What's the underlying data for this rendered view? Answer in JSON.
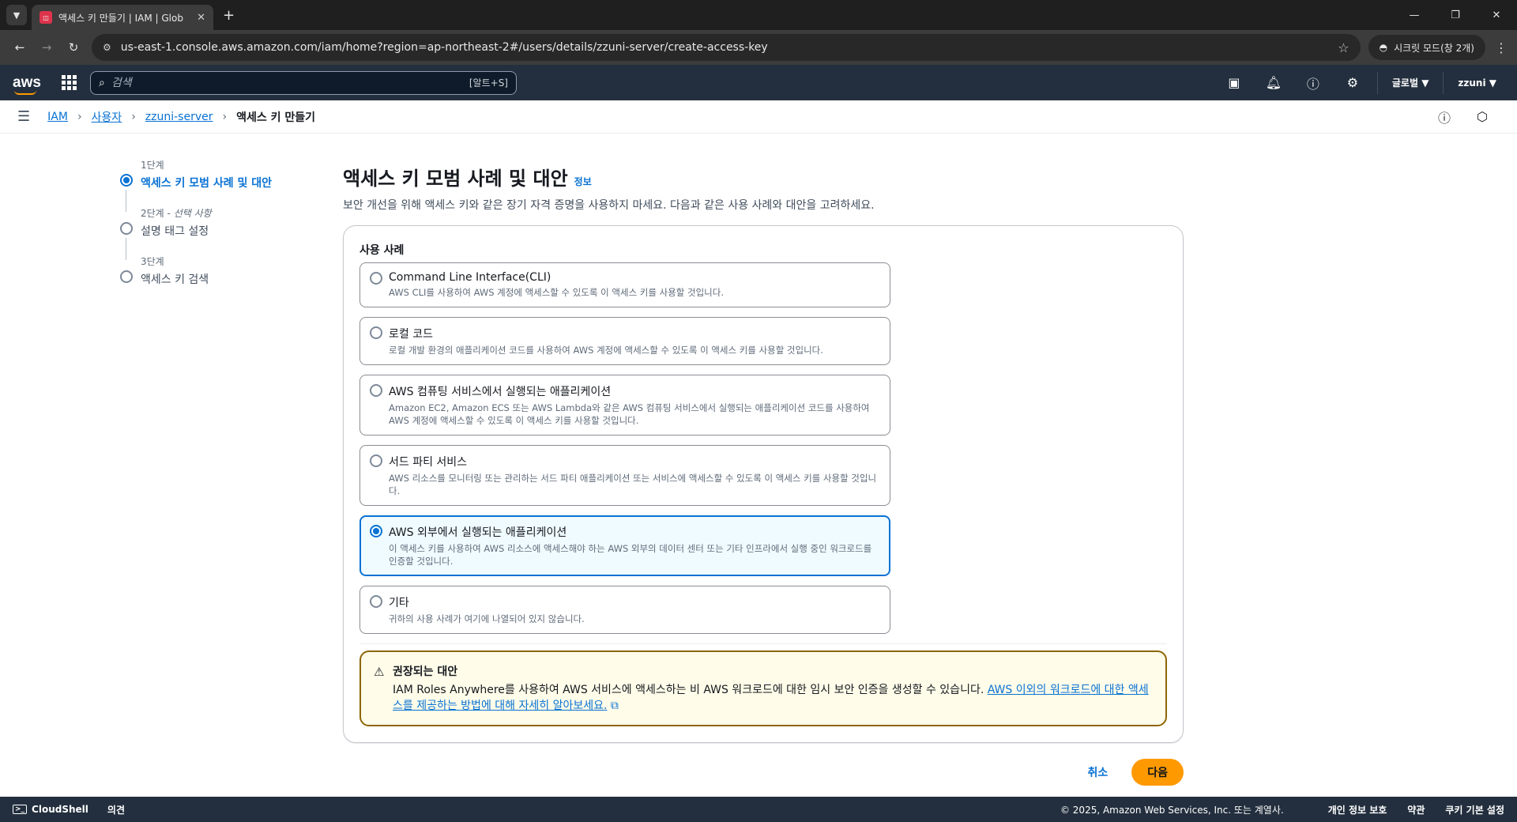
{
  "browser": {
    "tab_title": "액세스 키 만들기 | IAM | Glob",
    "url": "us-east-1.console.aws.amazon.com/iam/home?region=ap-northeast-2#/users/details/zzuni-server/create-access-key",
    "incognito_label": "시크릿 모드(창 2개)"
  },
  "awsnav": {
    "logo": "aws",
    "search_placeholder": "검색",
    "search_shortcut": "[알트+S]",
    "region": "글로벌 ▼",
    "account": "zzuni ▼"
  },
  "breadcrumb": {
    "items": [
      "IAM",
      "사용자",
      "zzuni-server"
    ],
    "current": "액세스 키 만들기"
  },
  "steps": [
    {
      "num": "1단계",
      "title": "액세스 키 모범 사례 및 대안"
    },
    {
      "num": "2단계",
      "optional": "선택 사항",
      "title": "설명 태그 설정"
    },
    {
      "num": "3단계",
      "title": "액세스 키 검색"
    }
  ],
  "main": {
    "title": "액세스 키 모범 사례 및 대안",
    "info": "정보",
    "description": "보안 개선을 위해 액세스 키와 같은 장기 자격 증명을 사용하지 마세요. 다음과 같은 사용 사례와 대안을 고려하세요.",
    "section_label": "사용 사례",
    "options": [
      {
        "title": "Command Line Interface(CLI)",
        "desc": "AWS CLI를 사용하여 AWS 계정에 액세스할 수 있도록 이 액세스 키를 사용할 것입니다."
      },
      {
        "title": "로컬 코드",
        "desc": "로컬 개발 환경의 애플리케이션 코드를 사용하여 AWS 계정에 액세스할 수 있도록 이 액세스 키를 사용할 것입니다."
      },
      {
        "title": "AWS 컴퓨팅 서비스에서 실행되는 애플리케이션",
        "desc": "Amazon EC2, Amazon ECS 또는 AWS Lambda와 같은 AWS 컴퓨팅 서비스에서 실행되는 애플리케이션 코드를 사용하여 AWS 계정에 액세스할 수 있도록 이 액세스 키를 사용할 것입니다."
      },
      {
        "title": "서드 파티 서비스",
        "desc": "AWS 리소스를 모니터링 또는 관리하는 서드 파티 애플리케이션 또는 서비스에 액세스할 수 있도록 이 액세스 키를 사용할 것입니다."
      },
      {
        "title": "AWS 외부에서 실행되는 애플리케이션",
        "desc": "이 액세스 키를 사용하여 AWS 리소스에 액세스해야 하는 AWS 외부의 데이터 센터 또는 기타 인프라에서 실행 중인 워크로드를 인증할 것입니다."
      },
      {
        "title": "기타",
        "desc": "귀하의 사용 사례가 여기에 나열되어 있지 않습니다."
      }
    ],
    "selected_index": 4,
    "alert": {
      "title": "권장되는 대안",
      "body": "IAM Roles Anywhere를 사용하여 AWS 서비스에 액세스하는 비 AWS 워크로드에 대한 임시 보안 인증을 생성할 수 있습니다. ",
      "link": "AWS 이외의 워크로드에 대한 액세스를 제공하는 방법에 대해 자세히 알아보세요."
    },
    "cancel": "취소",
    "next": "다음"
  },
  "footer": {
    "cloudshell": "CloudShell",
    "feedback": "의견",
    "copyright": "© 2025, Amazon Web Services, Inc. 또는 계열사.",
    "privacy": "개인 정보 보호",
    "terms": "약관",
    "cookies": "쿠키 기본 설정"
  }
}
